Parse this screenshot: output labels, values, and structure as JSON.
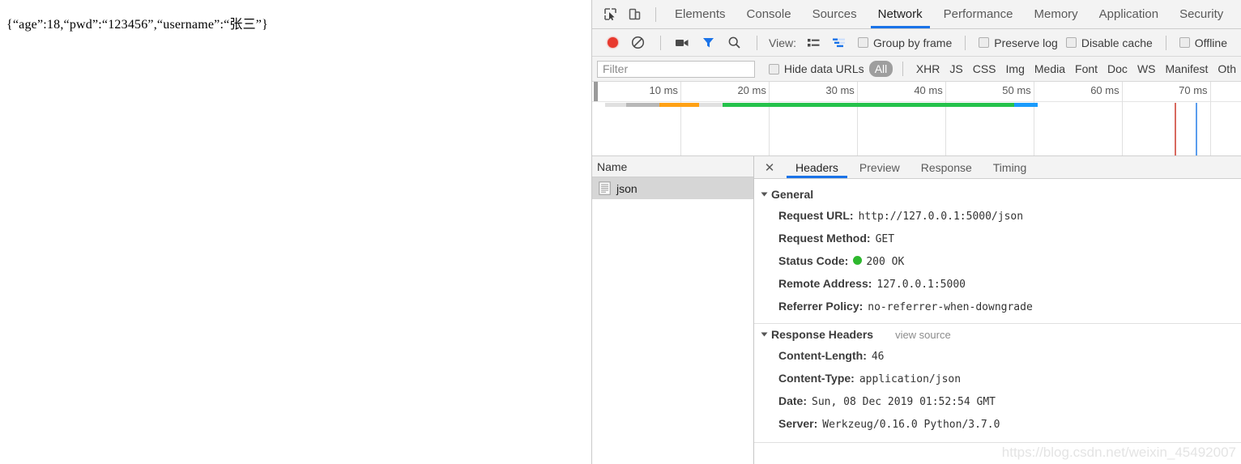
{
  "page": {
    "json_body": "{“age”:18,“pwd”:“123456”,“username”:“张三”}"
  },
  "devtools": {
    "tabs": [
      {
        "label": "Elements",
        "active": false
      },
      {
        "label": "Console",
        "active": false
      },
      {
        "label": "Sources",
        "active": false
      },
      {
        "label": "Network",
        "active": true
      },
      {
        "label": "Performance",
        "active": false
      },
      {
        "label": "Memory",
        "active": false
      },
      {
        "label": "Application",
        "active": false
      },
      {
        "label": "Security",
        "active": false
      }
    ],
    "toolbar": {
      "record_icon": "record-circle-icon",
      "clear_icon": "clear-no-entry-icon",
      "capture_screenshots_icon": "camera-icon",
      "filter_icon": "funnel-icon",
      "search_icon": "search-icon",
      "view_label": "View:",
      "view_list_icon": "list-view-icon",
      "view_waterfall_icon": "waterfall-view-icon",
      "group_by_frame": "Group by frame",
      "preserve_log": "Preserve log",
      "disable_cache": "Disable cache",
      "offline": "Offline"
    },
    "filterbar": {
      "placeholder": "Filter",
      "value": "",
      "hide_data_urls": "Hide data URLs",
      "all_pill": "All",
      "types": [
        "XHR",
        "JS",
        "CSS",
        "Img",
        "Media",
        "Font",
        "Doc",
        "WS",
        "Manifest",
        "Oth"
      ]
    },
    "overview": {
      "ticks": [
        {
          "label": "10 ms",
          "pct": 13.6
        },
        {
          "label": "20 ms",
          "pct": 27.2
        },
        {
          "label": "30 ms",
          "pct": 40.8
        },
        {
          "label": "40 ms",
          "pct": 54.4
        },
        {
          "label": "50 ms",
          "pct": 68.0
        },
        {
          "label": "60 ms",
          "pct": 81.6
        },
        {
          "label": "70 ms",
          "pct": 95.2
        }
      ],
      "segments": [
        {
          "name": "queueing",
          "color": "#e0e0e0",
          "start_pct": 2.0,
          "width_pct": 3.2
        },
        {
          "name": "stalled",
          "color": "#b8b8b8",
          "start_pct": 5.2,
          "width_pct": 5.2
        },
        {
          "name": "request-sent",
          "color": "#ffa115",
          "start_pct": 10.4,
          "width_pct": 6.1
        },
        {
          "name": "waiting",
          "color": "#e0e0e0",
          "start_pct": 16.5,
          "width_pct": 3.6
        },
        {
          "name": "content-download",
          "color": "#25c24b",
          "start_pct": 20.1,
          "width_pct": 45.0
        },
        {
          "name": "finish",
          "color": "#1a9bfc",
          "start_pct": 65.1,
          "width_pct": 3.6
        }
      ],
      "events": [
        {
          "name": "dom-content-loaded",
          "color": "#d8695f",
          "pct": 89.8
        },
        {
          "name": "load",
          "color": "#5a9ded",
          "pct": 93.0
        }
      ]
    },
    "requests": {
      "column_header": "Name",
      "rows": [
        {
          "name": "json",
          "icon": "document-icon",
          "selected": true
        }
      ]
    },
    "detail": {
      "close_icon": "close-icon",
      "tabs": [
        {
          "label": "Headers",
          "active": true
        },
        {
          "label": "Preview",
          "active": false
        },
        {
          "label": "Response",
          "active": false
        },
        {
          "label": "Timing",
          "active": false
        }
      ],
      "general": {
        "title": "General",
        "items": [
          {
            "key": "Request URL:",
            "value": "http://127.0.0.1:5000/json"
          },
          {
            "key": "Request Method:",
            "value": "GET"
          },
          {
            "key": "Status Code:",
            "value": "200 OK",
            "status_dot": "#2eb82e"
          },
          {
            "key": "Remote Address:",
            "value": "127.0.0.1:5000"
          },
          {
            "key": "Referrer Policy:",
            "value": "no-referrer-when-downgrade"
          }
        ]
      },
      "response_headers": {
        "title": "Response Headers",
        "view_source": "view source",
        "items": [
          {
            "key": "Content-Length:",
            "value": "46"
          },
          {
            "key": "Content-Type:",
            "value": "application/json"
          },
          {
            "key": "Date:",
            "value": "Sun, 08 Dec 2019 01:52:54 GMT"
          },
          {
            "key": "Server:",
            "value": "Werkzeug/0.16.0 Python/3.7.0"
          }
        ]
      }
    },
    "watermark": "https://blog.csdn.net/weixin_45492007"
  }
}
